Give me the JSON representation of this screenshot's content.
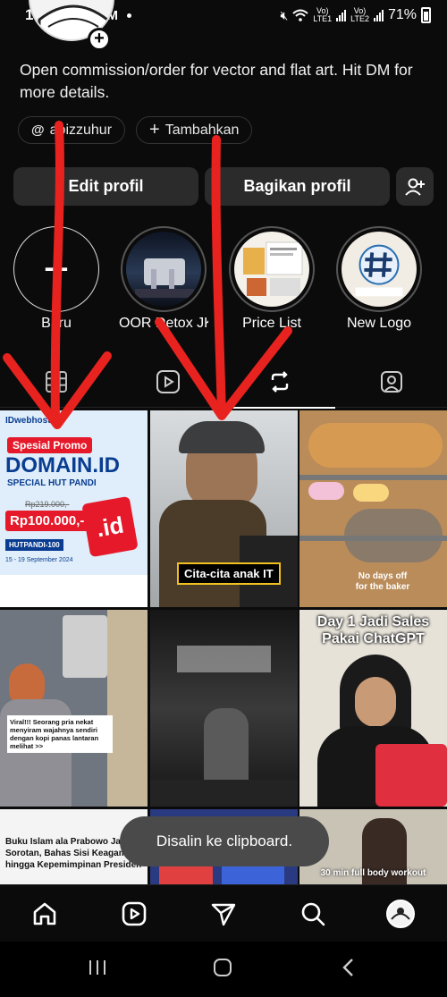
{
  "status": {
    "time": "19.00",
    "battery": "71%",
    "net1": "Vo)\nLTE1",
    "net2": "Vo)\nLTE2"
  },
  "profile": {
    "bio": "Open commission/order for vector and flat art. Hit DM for more details.",
    "threads_chip": "abizzuhur",
    "add_chip": "Tambahkan"
  },
  "actions": {
    "edit": "Edit profil",
    "share": "Bagikan profil"
  },
  "highlights": [
    {
      "label": "Baru"
    },
    {
      "label": "OOR Detox JK..."
    },
    {
      "label": "Price List"
    },
    {
      "label": "New Logo"
    }
  ],
  "grid": {
    "promo_brand": "IDwebhost",
    "promo_badge": "Spesial Promo",
    "promo_title": "DOMAIN.ID",
    "promo_sub": "SPECIAL HUT PANDI",
    "promo_old_price": "Rp219.000,-",
    "promo_price": "Rp100.000,-",
    "promo_code": "HUTPANDI-100",
    "promo_period": "15 - 19 September 2024",
    "cita_caption": "Cita-cita anak IT",
    "baker_caption": "No days off for the baker",
    "viral_caption": "Viral!!! Seorang pria nekat menyiram wajahnya sendiri dengan kopi panas lantaran melihat >>",
    "sales_caption": "Day 1 Jadi Sales Pakai ChatGPT",
    "islam_caption": "Buku Islam ala Prabowo Jadi Sorotan, Bahas Sisi Keagamaan hingga Kepemimpinan Presiden",
    "workout_caption": "30 min full body workout"
  },
  "toast": "Disalin ke clipboard.",
  "colors": {
    "background": "#0b0b0b",
    "button": "#2b2b2b",
    "annotation_red": "#e8231f",
    "toast": "#4a4a4a"
  },
  "icons": [
    "home-icon",
    "reels-icon",
    "send-icon",
    "search-icon",
    "avatar-icon",
    "grid-icon",
    "repost-icon",
    "tagged-icon",
    "add-person-icon",
    "threads-icon",
    "plus-icon"
  ]
}
